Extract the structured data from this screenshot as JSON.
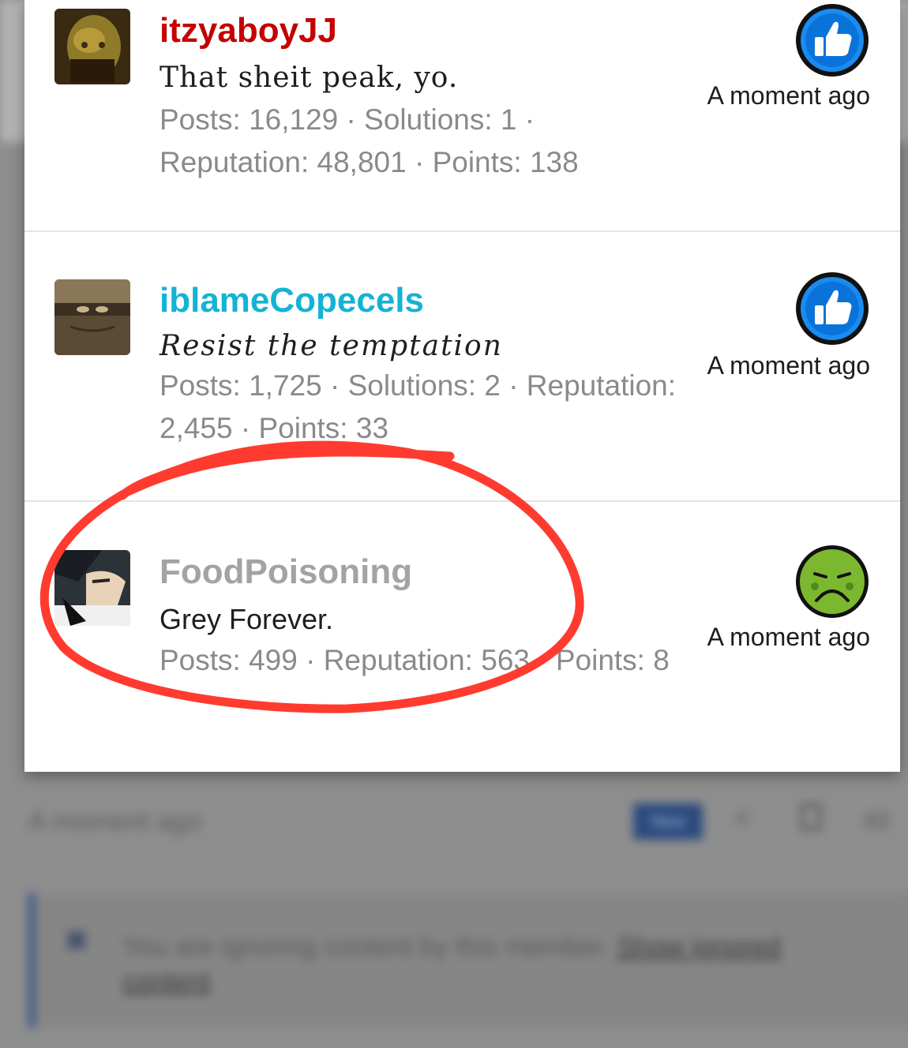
{
  "background": {
    "timestamp": "A moment ago",
    "new_badge": "New",
    "post_number": "#2",
    "ignore_notice": "You are ignoring content by this member.",
    "ignore_link": "Show ignored content",
    "accent_color": "#34528a"
  },
  "reactions": [
    {
      "username": "itzyaboyJJ",
      "username_color": "#c40000",
      "user_title": "That sheit peak, yo.",
      "stats": "Posts: 16,129 · Solutions: 1 · Reputation: 48,801 · Points: 138",
      "reaction": "like-icon",
      "time": "A moment ago"
    },
    {
      "username": "iblameCopecels",
      "username_color": "#13b3d3",
      "user_title": "Resist the temptation",
      "stats": "Posts: 1,725 · Solutions: 2 · Reputation: 2,455 · Points: 33",
      "reaction": "like-icon",
      "time": "A moment ago"
    },
    {
      "username": "FoodPoisoning",
      "username_color": "#a3a3a3",
      "user_title": "Grey Forever.",
      "stats": "Posts: 499 · Reputation: 563 · Points: 8",
      "reaction": "nauseated-face-icon",
      "time": "A moment ago"
    }
  ],
  "annotation": {
    "color": "#ff3b30"
  }
}
